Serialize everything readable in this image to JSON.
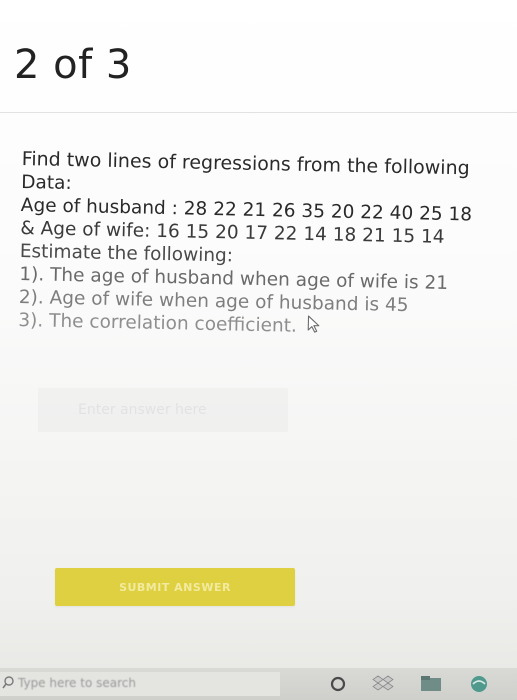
{
  "header": {
    "page_counter": "2 of 3"
  },
  "question": {
    "lines": [
      "Find two lines of regressions from the following",
      "Data:",
      "Age of husband : 28 22 21 26 35 20 22 40 25 18",
      "& Age of wife: 16 15 20 17 22 14 18 21 15 14",
      "Estimate the following:",
      "1). The age of husband when age of wife is 21",
      "2). Age of wife when age of husband is 45",
      "3). The correlation coefficient."
    ]
  },
  "answer": {
    "placeholder": "Enter answer here",
    "value": ""
  },
  "submit": {
    "label": "SUBMIT ANSWER"
  },
  "taskbar": {
    "search_placeholder": "Type here to search",
    "icons": [
      "search-icon",
      "cortana-circle-icon",
      "dropbox-icon",
      "file-explorer-icon",
      "browser-icon"
    ]
  },
  "colors": {
    "submit_bg": "#dfd041",
    "submit_text": "#f2ea9e",
    "taskbar_bg": "#d2d3cf",
    "text": "#2a2a2a"
  }
}
